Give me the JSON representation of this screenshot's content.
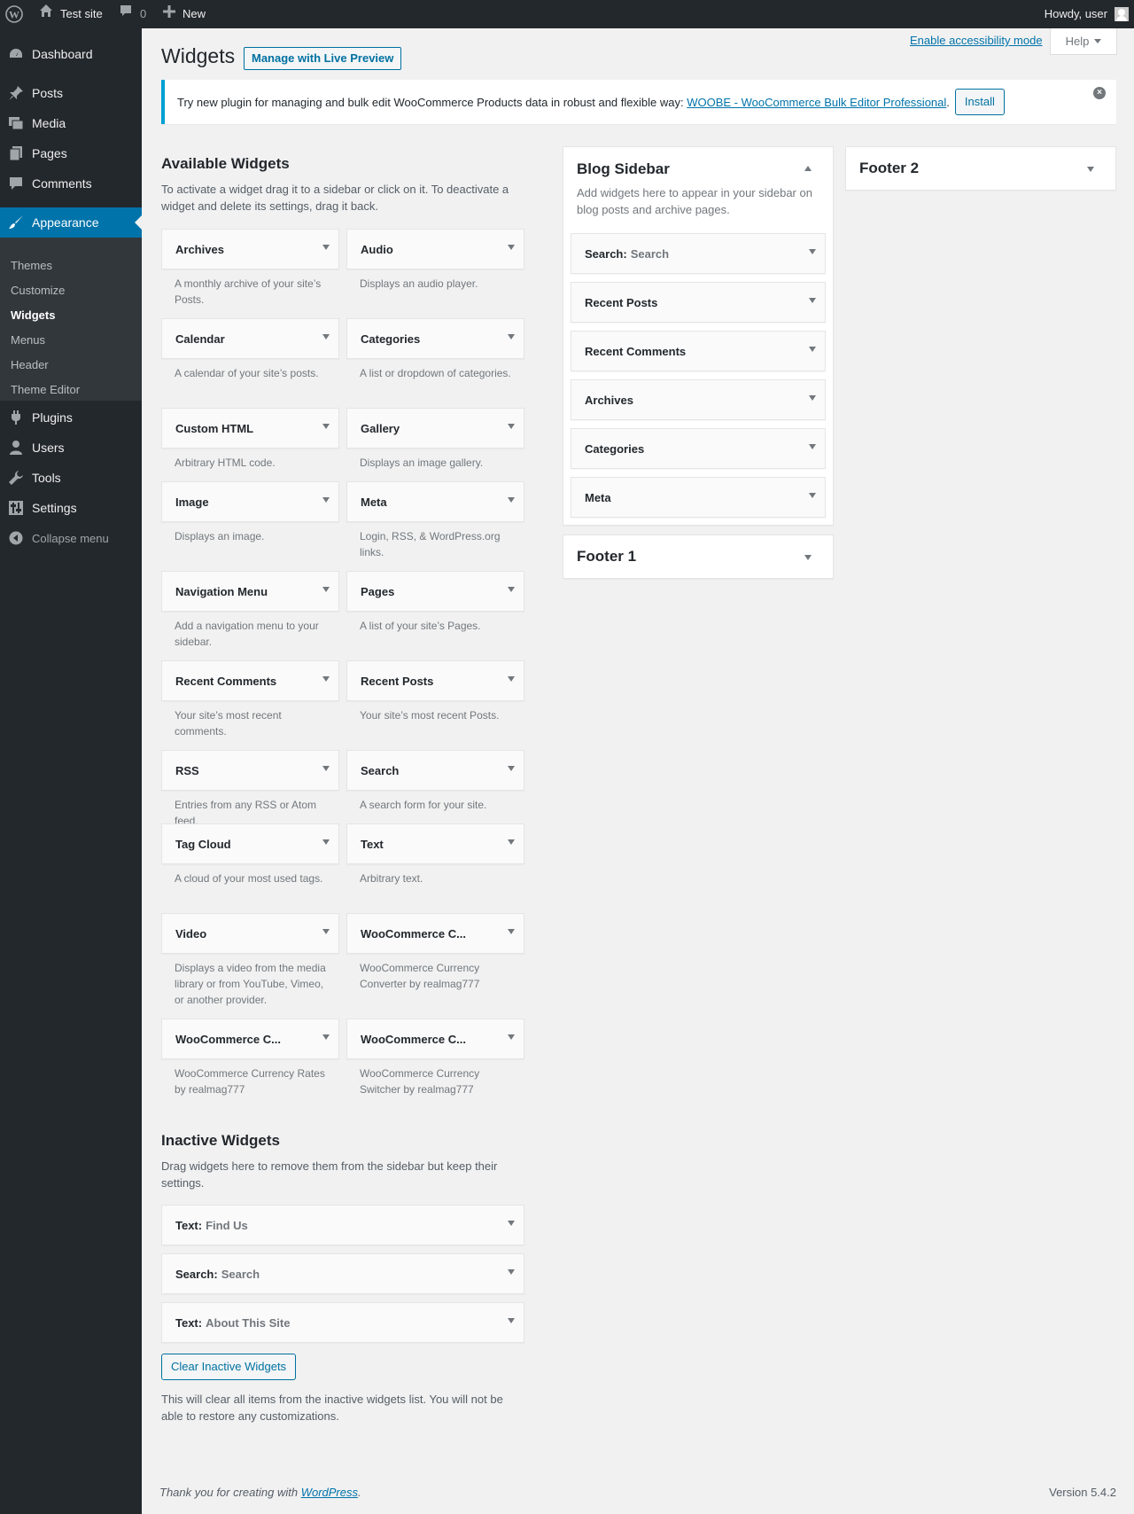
{
  "adminbar": {
    "site_name": "Test site",
    "comments_count": "0",
    "new_label": "New",
    "howdy": "Howdy, user"
  },
  "menu": {
    "dashboard": "Dashboard",
    "posts": "Posts",
    "media": "Media",
    "pages": "Pages",
    "comments": "Comments",
    "appearance": "Appearance",
    "submenu": {
      "themes": "Themes",
      "customize": "Customize",
      "widgets": "Widgets",
      "menus": "Menus",
      "header": "Header",
      "theme_editor": "Theme Editor"
    },
    "plugins": "Plugins",
    "users": "Users",
    "tools": "Tools",
    "settings": "Settings",
    "collapse": "Collapse menu"
  },
  "header": {
    "accessibility_link": "Enable accessibility mode",
    "help_label": "Help",
    "title": "Widgets",
    "live_preview": "Manage with Live Preview"
  },
  "notice": {
    "text": "Try new plugin for managing and bulk edit WooCommerce Products data in robust and flexible way:",
    "link": "WOOBE - WooCommerce Bulk Editor Professional",
    "period": ".",
    "install": "Install"
  },
  "available": {
    "heading": "Available Widgets",
    "description": "To activate a widget drag it to a sidebar or click on it. To deactivate a widget and delete its settings, drag it back.",
    "widgets": [
      {
        "title": "Archives",
        "desc": "A monthly archive of your site’s Posts."
      },
      {
        "title": "Audio",
        "desc": "Displays an audio player."
      },
      {
        "title": "Calendar",
        "desc": "A calendar of your site’s posts."
      },
      {
        "title": "Categories",
        "desc": "A list or dropdown of categories."
      },
      {
        "title": "Custom HTML",
        "desc": "Arbitrary HTML code."
      },
      {
        "title": "Gallery",
        "desc": "Displays an image gallery."
      },
      {
        "title": "Image",
        "desc": "Displays an image."
      },
      {
        "title": "Meta",
        "desc": "Login, RSS, & WordPress.org links."
      },
      {
        "title": "Navigation Menu",
        "desc": "Add a navigation menu to your sidebar."
      },
      {
        "title": "Pages",
        "desc": "A list of your site’s Pages."
      },
      {
        "title": "Recent Comments",
        "desc": "Your site’s most recent comments."
      },
      {
        "title": "Recent Posts",
        "desc": "Your site’s most recent Posts."
      },
      {
        "title": "RSS",
        "desc": "Entries from any RSS or Atom feed."
      },
      {
        "title": "Search",
        "desc": "A search form for your site."
      },
      {
        "title": "Tag Cloud",
        "desc": "A cloud of your most used tags."
      },
      {
        "title": "Text",
        "desc": "Arbitrary text."
      },
      {
        "title": "Video",
        "desc": "Displays a video from the media library or from YouTube, Vimeo, or another provider."
      },
      {
        "title": "WooCommerce C...",
        "desc": "WooCommerce Currency Converter by realmag777"
      },
      {
        "title": "WooCommerce C...",
        "desc": "WooCommerce Currency Rates by realmag777"
      },
      {
        "title": "WooCommerce C...",
        "desc": "WooCommerce Currency Switcher by realmag777"
      }
    ]
  },
  "inactive": {
    "heading": "Inactive Widgets",
    "description": "Drag widgets here to remove them from the sidebar but keep their settings.",
    "widgets": [
      {
        "title": "Text:",
        "sub": "Find Us"
      },
      {
        "title": "Search:",
        "sub": "Search"
      },
      {
        "title": "Text:",
        "sub": "About This Site"
      }
    ],
    "clear_button": "Clear Inactive Widgets",
    "clear_note": "This will clear all items from the inactive widgets list. You will not be able to restore any customizations."
  },
  "blog_sidebar": {
    "title": "Blog Sidebar",
    "description": "Add widgets here to appear in your sidebar on blog posts and archive pages.",
    "widgets": [
      {
        "title": "Search:",
        "sub": "Search"
      },
      {
        "title": "Recent Posts",
        "sub": ""
      },
      {
        "title": "Recent Comments",
        "sub": ""
      },
      {
        "title": "Archives",
        "sub": ""
      },
      {
        "title": "Categories",
        "sub": ""
      },
      {
        "title": "Meta",
        "sub": ""
      }
    ]
  },
  "footer1": {
    "title": "Footer 1"
  },
  "footer2": {
    "title": "Footer 2"
  },
  "footer": {
    "thanks": "Thank you for creating with",
    "wp_link": "WordPress",
    "period": ".",
    "version": "Version 5.4.2"
  }
}
